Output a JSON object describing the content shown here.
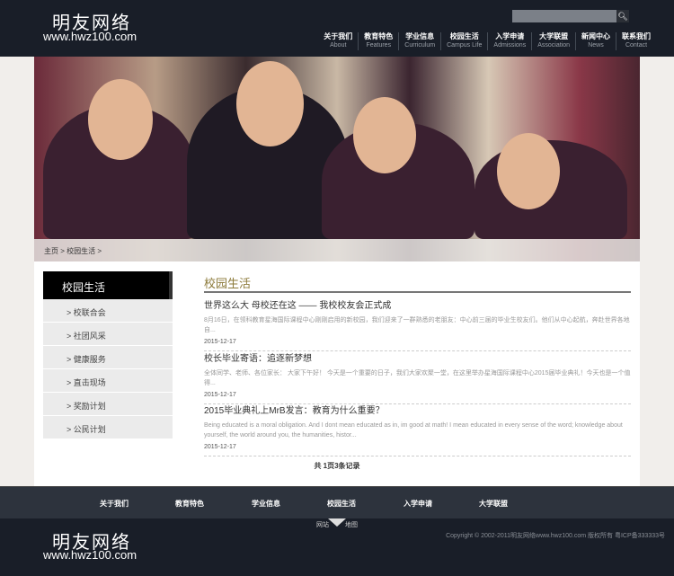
{
  "header": {
    "logo_cn": "明友网络",
    "logo_en": "www.hwz100.com",
    "search_placeholder": "",
    "search_icon": "search-icon",
    "nav": [
      {
        "cn": "关于我们",
        "en": "About"
      },
      {
        "cn": "教育特色",
        "en": "Features"
      },
      {
        "cn": "学业信息",
        "en": "Curriculum"
      },
      {
        "cn": "校园生活",
        "en": "Campus Life"
      },
      {
        "cn": "入学申请",
        "en": "Admissions"
      },
      {
        "cn": "大学联盟",
        "en": "Association"
      },
      {
        "cn": "新闻中心",
        "en": "News"
      },
      {
        "cn": "联系我们",
        "en": "Contact"
      }
    ]
  },
  "breadcrumb": "主页 > 校园生活 >",
  "sidebar": {
    "title": "校园生活",
    "items": [
      "> 校联合会",
      "> 社团风采",
      "> 健康服务",
      "> 直击现场",
      "> 奖励计划",
      "> 公民计划"
    ]
  },
  "main": {
    "title": "校园生活",
    "articles": [
      {
        "title": "世界这么大 母校还在这 —— 我校校友会正式成",
        "summary": "8月16日，在领科教育星海国际课程中心刚刚启用的新校园，我们迎来了一群熟悉的老朋友：中心前三届的毕业生校友们。他们从中心起航，奔赴世界各地自...",
        "date": "2015-12-17"
      },
      {
        "title": "校长毕业寄语：追逐新梦想",
        "summary": "全体同学、老师、各位家长： 大家下午好！ 今天是一个重要的日子，我们大家欢聚一堂，在这里举办星海国际课程中心2015届毕业典礼！今天也是一个值得...",
        "date": "2015-12-17"
      },
      {
        "title": "2015毕业典礼上MrB发言：教育为什么重要？",
        "summary": "Being educated is a moral obligation. And I dont mean educated as in, im good at math! I mean educated in every sense of the word; knowledge about yourself, the world around you, the humanities, histor...",
        "date": "2015-12-17"
      }
    ],
    "pager": "共 1页3条记录"
  },
  "footer": {
    "nav": [
      "关于我们",
      "教育特色",
      "学业信息",
      "校园生活",
      "入学申请",
      "大学联盟"
    ],
    "sitemap_left": "网站",
    "sitemap_right": "地图",
    "logo_cn": "明友网络",
    "logo_en": "www.hwz100.com",
    "copyright": "Copyright © 2002-2011明友网络www.hwz100.com 版权所有 粤ICP备333333号"
  }
}
